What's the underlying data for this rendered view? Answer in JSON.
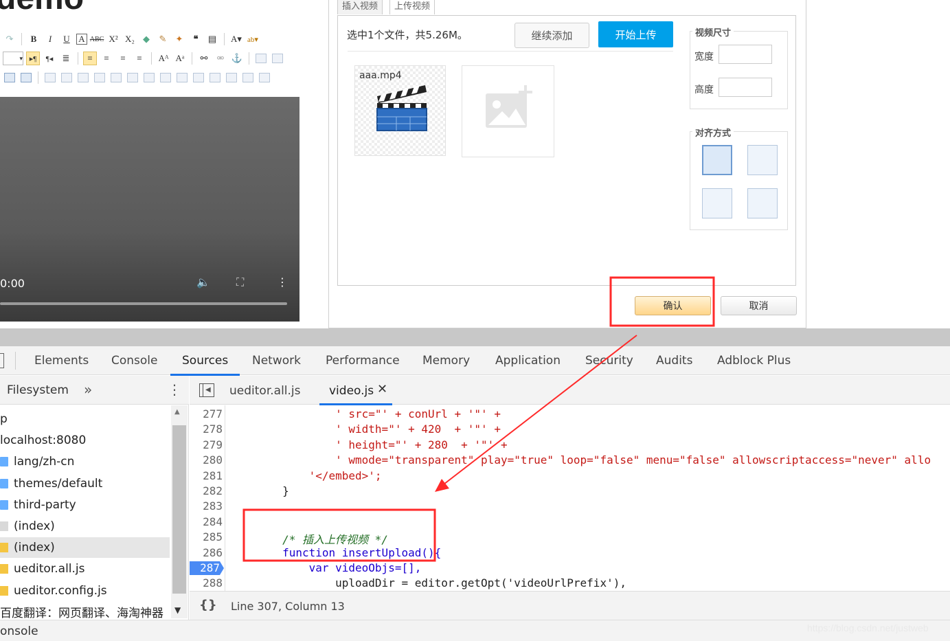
{
  "editor": {
    "page_title_fragment": "demo",
    "video": {
      "time": "0:00"
    }
  },
  "dialog": {
    "tabs": [
      "插入视频",
      "上传视频"
    ],
    "selected_text": "选中1个文件，共5.26M。",
    "continue_button": "继续添加",
    "start_button": "开始上传",
    "file_name": "aaa.mp4",
    "size_section": {
      "title": "视频尺寸",
      "width_label": "宽度",
      "height_label": "高度",
      "width_value": "",
      "height_value": ""
    },
    "align_section": {
      "title": "对齐方式"
    },
    "ok_button": "确认",
    "cancel_button": "取消"
  },
  "devtools": {
    "tabs": [
      "Elements",
      "Console",
      "Sources",
      "Network",
      "Performance",
      "Memory",
      "Application",
      "Security",
      "Audits",
      "Adblock Plus"
    ],
    "active_tab": "Sources",
    "navigator": {
      "tab": "Filesystem",
      "items": [
        {
          "label": "p",
          "icon": "none"
        },
        {
          "label": "localhost:8080",
          "icon": "none"
        },
        {
          "label": "lang/zh-cn",
          "icon": "folder"
        },
        {
          "label": "themes/default",
          "icon": "folder"
        },
        {
          "label": "third-party",
          "icon": "folder"
        },
        {
          "label": "(index)",
          "icon": "file"
        },
        {
          "label": "(index)",
          "icon": "file-yellow"
        },
        {
          "label": "ueditor.all.js",
          "icon": "file-yellow"
        },
        {
          "label": "ueditor.config.js",
          "icon": "file-yellow"
        },
        {
          "label": "百度翻译：网页翻译、海淘神器",
          "icon": "none"
        }
      ]
    },
    "file_tabs": [
      "ueditor.all.js",
      "video.js"
    ],
    "active_file": "video.js",
    "code": {
      "line_numbers": [
        "277",
        "278",
        "279",
        "280",
        "281",
        "282",
        "283",
        "284",
        "285",
        "286",
        "287",
        "288"
      ],
      "breakpoint_line": "287",
      "lines": [
        "                ' src=\"' + conUrl + '\"' +",
        "                ' width=\"' + 420  + '\"' +",
        "                ' height=\"' + 280  + '\"' +",
        "                ' wmode=\"transparent\" play=\"true\" loop=\"false\" menu=\"false\" allowscriptaccess=\"never\" allo",
        "            '</embed>';",
        "        }",
        "",
        "",
        "        /* 插入上传视频 */",
        "        function insertUpload(){",
        "            var videoObjs=[],",
        "                uploadDir = editor.getOpt('videoUrlPrefix'),"
      ]
    },
    "status": "Line 307, Column 13",
    "console_label": "onsole"
  },
  "watermark": "https://blog.csdn.net/justweb",
  "colors": {
    "accent_blue": "#00a0e9",
    "annotation_red": "#ff2a2a",
    "devtools_blue": "#1a73e8"
  }
}
